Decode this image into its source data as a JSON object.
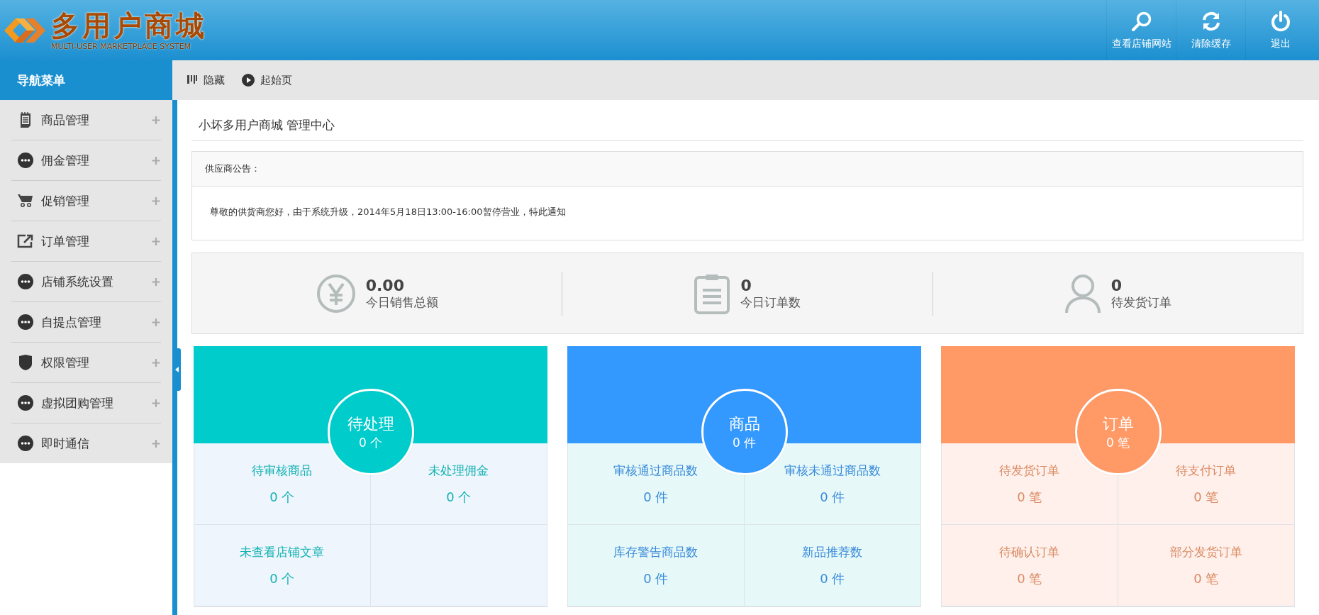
{
  "header": {
    "logo_title": "多用户商城",
    "logo_subtitle": "MULTI-USER MARKETPLACE SYSTEM",
    "actions": [
      {
        "label": "查看店铺网站",
        "kind": "search"
      },
      {
        "label": "清除缓存",
        "kind": "refresh"
      },
      {
        "label": "退出",
        "kind": "power"
      }
    ]
  },
  "sidebar": {
    "title": "导航菜单",
    "items": [
      {
        "label": "商品管理",
        "kind": "notepad",
        "expanded": false
      },
      {
        "label": "佣金管理",
        "kind": "dots",
        "expanded": false
      },
      {
        "label": "促销管理",
        "kind": "cart",
        "expanded": false
      },
      {
        "label": "订单管理",
        "kind": "share",
        "expanded": false
      },
      {
        "label": "店铺系统设置",
        "kind": "dots",
        "expanded": false
      },
      {
        "label": "自提点管理",
        "kind": "dots",
        "expanded": false
      },
      {
        "label": "权限管理",
        "kind": "shield",
        "expanded": false
      },
      {
        "label": "虚拟团购管理",
        "kind": "dots",
        "expanded": false
      },
      {
        "label": "即时通信",
        "kind": "dots",
        "expanded": false
      }
    ]
  },
  "toolbar": [
    {
      "label": "隐藏",
      "kind": "bars"
    },
    {
      "label": "起始页",
      "kind": "play"
    }
  ],
  "page_title": "小坏多用户商城 管理中心",
  "notice": {
    "title": "供应商公告：",
    "text": "尊敬的供货商您好，由于系统升级，2014年5月18日13:00-16:00暂停营业，特此通知"
  },
  "stats": [
    {
      "value": "0.00",
      "label": "今日销售总额",
      "kind": "yen"
    },
    {
      "value": "0",
      "label": "今日订单数",
      "kind": "clipboard"
    },
    {
      "value": "0",
      "label": "待发货订单",
      "kind": "person"
    }
  ],
  "cards": [
    {
      "title": "待处理",
      "count": "0 个",
      "color": "#00cccc",
      "cells": [
        {
          "label": "待审核商品",
          "value": "0 个"
        },
        {
          "label": "未处理佣金",
          "value": "0 个"
        },
        {
          "label": "未查看店铺文章",
          "value": "0 个"
        }
      ]
    },
    {
      "title": "商品",
      "count": "0 件",
      "color": "#3399ff",
      "cells": [
        {
          "label": "审核通过商品数",
          "value": "0 件"
        },
        {
          "label": "审核未通过商品数",
          "value": "0 件"
        },
        {
          "label": "库存警告商品数",
          "value": "0 件"
        },
        {
          "label": "新品推荐数",
          "value": "0 件"
        }
      ]
    },
    {
      "title": "订单",
      "count": "0 笔",
      "color": "#ff9966",
      "cells": [
        {
          "label": "待发货订单",
          "value": "0 笔"
        },
        {
          "label": "待支付订单",
          "value": "0 笔"
        },
        {
          "label": "待确认订单",
          "value": "0 笔"
        },
        {
          "label": "部分发货订单",
          "value": "0 笔"
        }
      ]
    }
  ]
}
